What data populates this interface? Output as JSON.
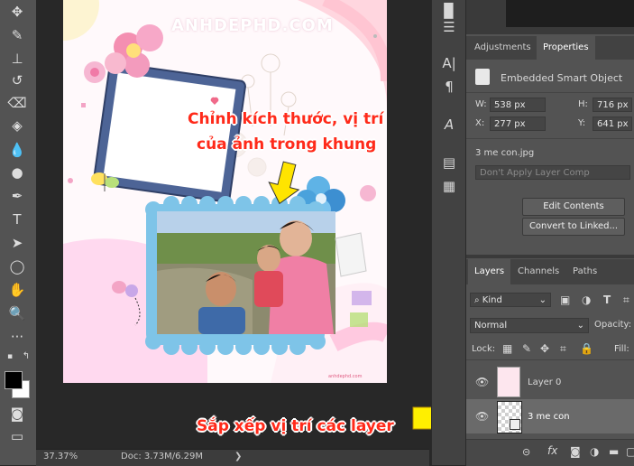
{
  "statusbar": {
    "zoom": "37.37%",
    "doc": "Doc: 3.73M/6.29M",
    "arrow": "❯"
  },
  "canvas": {
    "watermark": "ANHDEPHD.COM",
    "small_logo": "anhdephd.com",
    "callout_top": [
      "Chỉnh kích thước, vị trí",
      "của ảnh trong khung"
    ],
    "callout_bottom": "Sắp xếp vị trí các layer"
  },
  "properties": {
    "tabs": [
      "Adjustments",
      "Properties"
    ],
    "active_tab": "Properties",
    "object_type": "Embedded Smart Object",
    "w_label": "W:",
    "w_value": "538 px",
    "h_label": "H:",
    "h_value": "716 px",
    "x_label": "X:",
    "x_value": "277 px",
    "y_label": "Y:",
    "y_value": "641 px",
    "filename": "3 me con.jpg",
    "layer_comp_placeholder": "Don't Apply Layer Comp",
    "edit_contents": "Edit Contents",
    "convert_linked": "Convert to Linked..."
  },
  "layers": {
    "tabs": [
      "Layers",
      "Channels",
      "Paths"
    ],
    "active_tab": "Layers",
    "filter": "Kind",
    "blend_mode": "Normal",
    "opacity_label": "Opacity:",
    "lock_label": "Lock:",
    "fill_label": "Fill:",
    "items": [
      {
        "name": "Layer 0",
        "visible": true,
        "selected": false
      },
      {
        "name": "3 me con",
        "visible": true,
        "selected": true
      }
    ]
  },
  "colors": {
    "callout_text": "#ff2a1a",
    "arrow_fill": "#ffef00",
    "frame_blue": "#4d6496",
    "scallop_blue": "#7ec4e8",
    "panel_bg": "#535353"
  },
  "icons": {
    "toolbar": [
      "move-icon",
      "marquee-icon",
      "lasso-icon",
      "magic-wand-icon",
      "crop-icon",
      "eyedropper-icon",
      "healing-icon",
      "brush-icon",
      "stamp-icon",
      "history-brush-icon",
      "eraser-icon",
      "paint-bucket-icon",
      "blur-icon",
      "dodge-icon",
      "pen-icon",
      "type-icon",
      "path-select-icon",
      "shape-icon",
      "hand-icon",
      "zoom-icon",
      "more-icon"
    ],
    "midstrip": [
      "properties-icon",
      "adjust-icon",
      "character-icon",
      "paragraph-icon",
      "glyphs-icon",
      "libraries-icon",
      "notes-icon"
    ]
  }
}
